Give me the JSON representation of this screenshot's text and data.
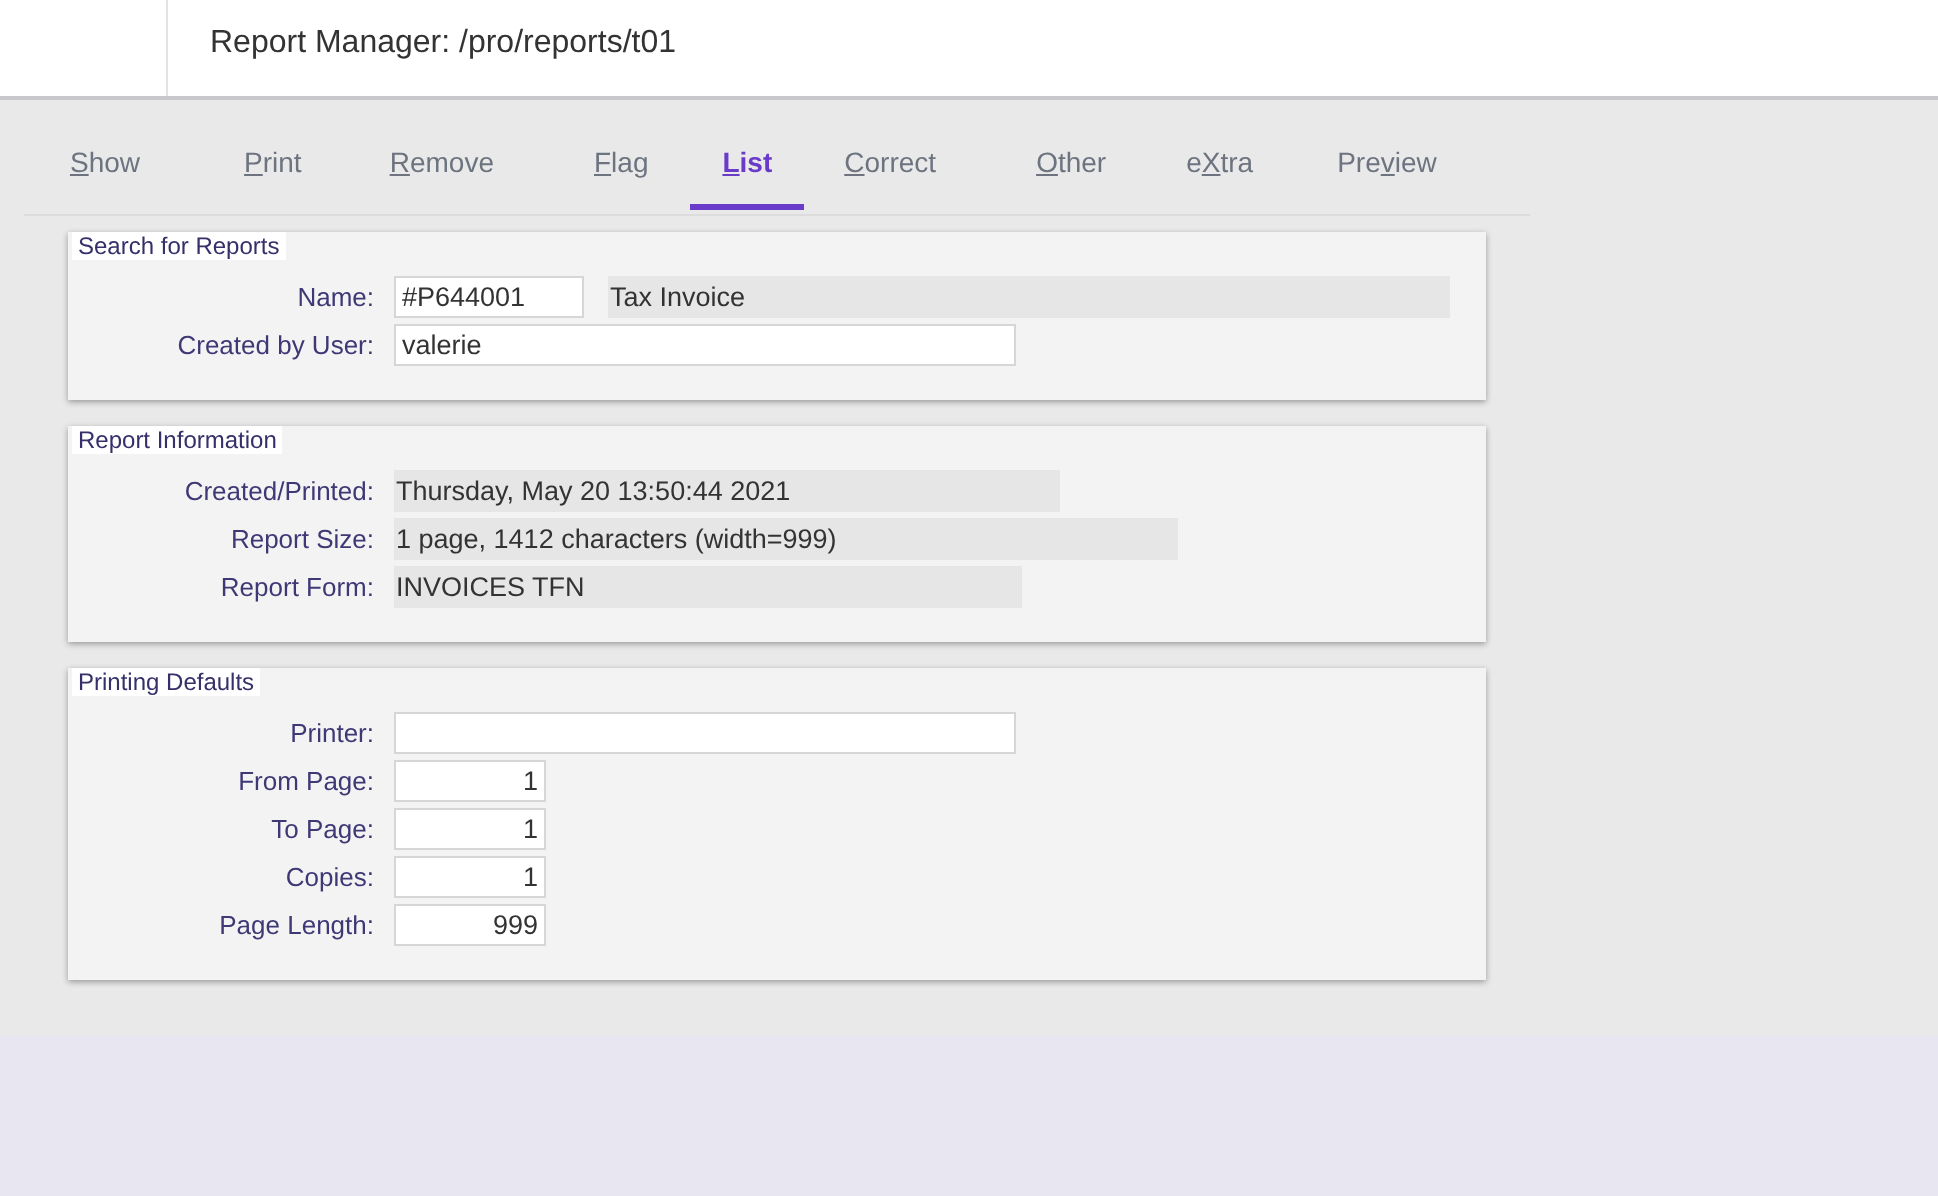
{
  "header": {
    "title": "Report Manager: /pro/reports/t01"
  },
  "tabs": [
    {
      "key": "S",
      "post": "how",
      "selected": false
    },
    {
      "key": "P",
      "post": "rint",
      "selected": false
    },
    {
      "key": "R",
      "post": "emove",
      "selected": false
    },
    {
      "key": "F",
      "post": "lag",
      "selected": false
    },
    {
      "key": "L",
      "post": "ist",
      "selected": true
    },
    {
      "key": "C",
      "post": "orrect",
      "selected": false
    },
    {
      "key": "O",
      "post": "ther",
      "selected": false
    },
    {
      "pre": "e",
      "key": "X",
      "post": "tra",
      "selected": false
    },
    {
      "pre": "Pre",
      "key": "v",
      "post": "iew",
      "selected": false
    }
  ],
  "panels": [
    {
      "title": "Search for Reports",
      "rows": [
        {
          "label": "Name:",
          "fields": [
            {
              "kind": "code",
              "value": "#P644001"
            },
            {
              "kind": "display",
              "value": "Tax Invoice"
            }
          ]
        },
        {
          "label": "Created by User:",
          "fields": [
            {
              "kind": "text",
              "value": "valerie"
            }
          ]
        }
      ]
    },
    {
      "title": "Report Information",
      "rows": [
        {
          "label": "Created/Printed:",
          "fields": [
            {
              "kind": "display",
              "value": "Thursday, May 20 13:50:44 2021"
            }
          ]
        },
        {
          "label": "Report Size:",
          "fields": [
            {
              "kind": "display",
              "value": "1 page, 1412 characters (width=999)"
            }
          ]
        },
        {
          "label": "Report Form:",
          "fields": [
            {
              "kind": "display",
              "value": "INVOICES TFN"
            }
          ]
        }
      ]
    },
    {
      "title": "Printing Defaults",
      "rows": [
        {
          "label": "Printer:",
          "fields": [
            {
              "kind": "text"
            }
          ]
        },
        {
          "label": "From Page:",
          "fields": [
            {
              "kind": "number",
              "value": "1"
            }
          ]
        },
        {
          "label": "To Page:",
          "fields": [
            {
              "kind": "number",
              "value": "1"
            }
          ]
        },
        {
          "label": "Copies:",
          "fields": [
            {
              "kind": "number",
              "value": "1"
            }
          ]
        },
        {
          "label": "Page Length:",
          "fields": [
            {
              "kind": "number",
              "value": "999"
            }
          ]
        }
      ]
    }
  ]
}
